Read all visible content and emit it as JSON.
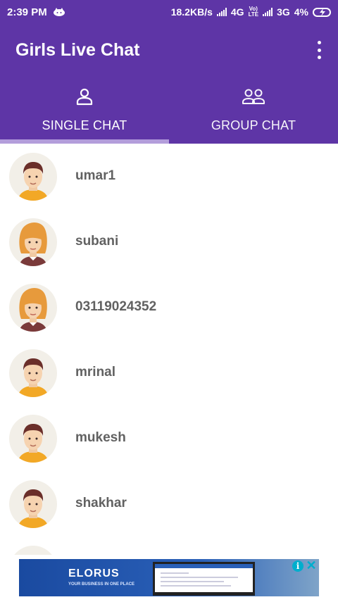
{
  "status_bar": {
    "time": "2:39 PM",
    "net_speed": "18.2KB/s",
    "sim1_type": "4G",
    "volte_top": "Vo)",
    "volte_bottom": "LTE",
    "sim2_type": "3G",
    "battery": "4%"
  },
  "app_bar": {
    "title": "Girls Live Chat",
    "menu_icon": "more-vert-icon"
  },
  "tabs": [
    {
      "label": "SINGLE CHAT",
      "icon": "person-icon",
      "selected": true
    },
    {
      "label": "GROUP CHAT",
      "icon": "group-icon",
      "selected": false
    }
  ],
  "users": [
    {
      "name": "umar1",
      "avatar": "male"
    },
    {
      "name": "subani",
      "avatar": "female"
    },
    {
      "name": "03119024352",
      "avatar": "female"
    },
    {
      "name": "mrinal",
      "avatar": "male"
    },
    {
      "name": "mukesh",
      "avatar": "male"
    },
    {
      "name": "shakhar",
      "avatar": "male"
    }
  ],
  "ad": {
    "brand": "ELORUS",
    "tagline": "YOUR BUSINESS IN ONE PLACE"
  },
  "colors": {
    "primary": "#5e35a6",
    "indicator": "#b39ddb",
    "name_text": "#616161"
  }
}
